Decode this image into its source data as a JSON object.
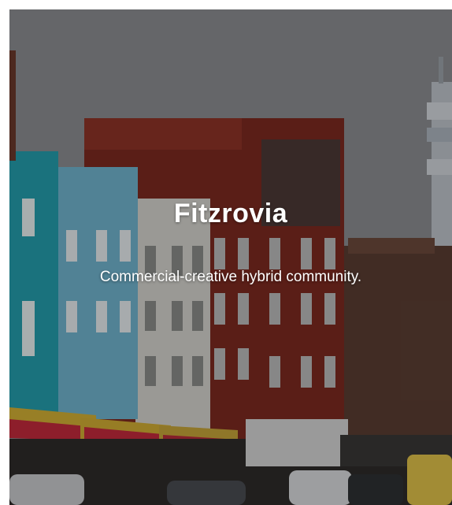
{
  "card": {
    "title": "Fitzrovia",
    "subtitle": "Commercial-creative hybrid community."
  },
  "colors": {
    "sky": "#8e8e92",
    "teal_building": "#2aa5b4",
    "light_blue_building": "#73b7d0",
    "white_building": "#d9d8d2",
    "brick_building": "#8a2f24",
    "tower": "#c8cdd3",
    "awning": "#c42a3c",
    "text": "#ffffff"
  }
}
